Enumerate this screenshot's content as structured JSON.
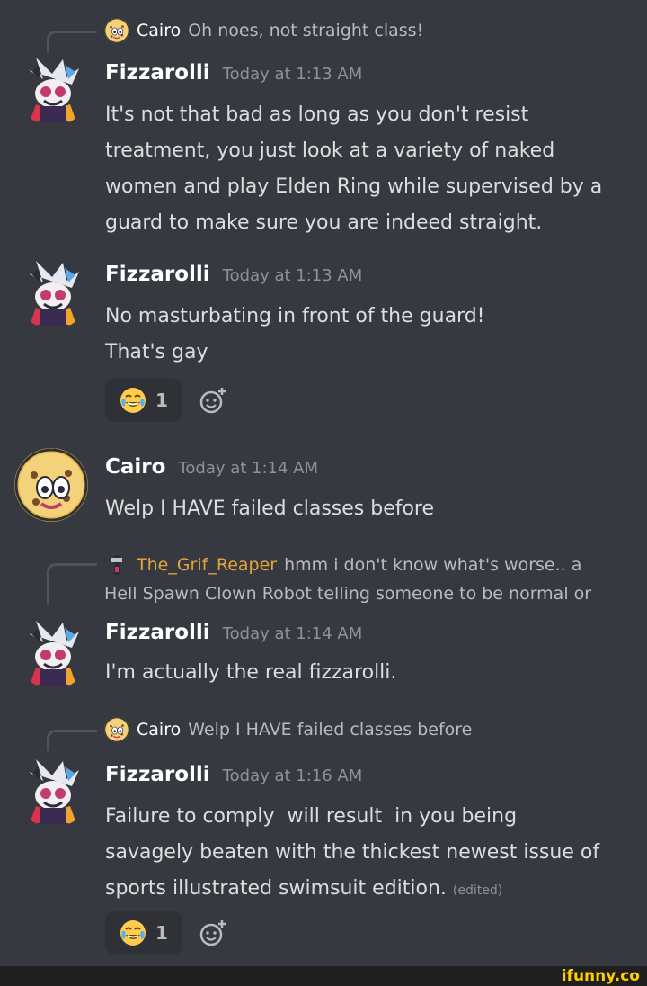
{
  "colors": {
    "background": "#36393f",
    "username": "#ffffff",
    "reaper": "#e3a53b",
    "timestamp": "#8e9297",
    "text": "#dcddde",
    "watermark": "#ffcc00"
  },
  "messages": [
    {
      "reply": {
        "name": "Cairo",
        "text": "Oh noes, not straight class!",
        "avatar_icon": "cairo-avatar-icon"
      },
      "author": "Fizzarolli",
      "time": "Today at 1:13 AM",
      "text": "It's not that bad as long as you don't resist\ntreatment, you just look at a variety of naked\nwomen and play Elden Ring while supervised by a\nguard to make sure you are indeed straight."
    },
    {
      "author": "Fizzarolli",
      "time": "Today at 1:13 AM",
      "text": "No masturbating in front of the guard!\nThat's gay",
      "reaction": {
        "emoji": "joy-emoji-icon",
        "count": "1"
      }
    },
    {
      "author": "Cairo",
      "time": "Today at 1:14 AM",
      "text": "Welp I HAVE failed classes before"
    },
    {
      "reply": {
        "name": "The_Grif_Reaper",
        "text": "hmm i don't know what's worse.. a",
        "text2": "Hell Spawn Clown Robot telling someone to be normal or",
        "avatar_icon": "reaper-avatar-icon"
      },
      "author": "Fizzarolli",
      "time": "Today at 1:14 AM",
      "text": "I'm actually the real fizzarolli."
    },
    {
      "reply": {
        "name": "Cairo",
        "text": "Welp I HAVE failed classes before",
        "avatar_icon": "cairo-avatar-icon"
      },
      "author": "Fizzarolli",
      "time": "Today at 1:16 AM",
      "text": "Failure to comply  will result  in you being\nsavagely beaten with the thickest newest issue of\nsports illustrated swimsuit edition.",
      "edited": "(edited)",
      "reaction": {
        "emoji": "joy-emoji-icon",
        "count": "1"
      }
    }
  ],
  "watermark": "ifunny.co"
}
